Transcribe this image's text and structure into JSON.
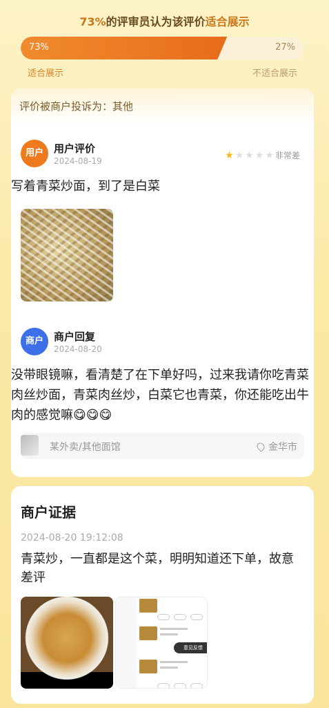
{
  "header": {
    "percent": "73%",
    "middle": "的评审员认为该评价",
    "verdict": "适合展示"
  },
  "vote": {
    "agree_pct": "73%",
    "disagree_pct": "27%",
    "agree_fraction": 0.73,
    "agree_label": "适合展示",
    "disagree_label": "不适合展示"
  },
  "complaint": {
    "text": "评价被商户投诉为：其他"
  },
  "user_review": {
    "avatar": "用户",
    "role": "用户评价",
    "date": "2024-08-19",
    "stars": 1,
    "max_stars": 5,
    "rating_text": "非常差",
    "text": "写着青菜炒面，到了是白菜"
  },
  "merchant_reply": {
    "avatar": "商户",
    "role": "商户回复",
    "date": "2024-08-20",
    "text": "没带眼镜嘛，看清楚了在下单好吗，过来我请你吃青菜肉丝炒面，青菜肉丝炒，白菜它也青菜，你还能吃出牛肉的感觉嘛😋😋😋"
  },
  "shop": {
    "name": "某外卖/其他面馆",
    "city": "金华市",
    "icon": "location-pin-icon"
  },
  "evidence": {
    "title": "商户证据",
    "time": "2024-08-20 19:12:08",
    "text": "青菜炒，一直都是这个菜，明明知道还下单，故意差评",
    "screenshot_feedback": "意见反馈"
  },
  "colors": {
    "accent_orange": "#e86c1a",
    "merchant_blue": "#3c6fe8",
    "star_gold": "#f5b81d"
  }
}
